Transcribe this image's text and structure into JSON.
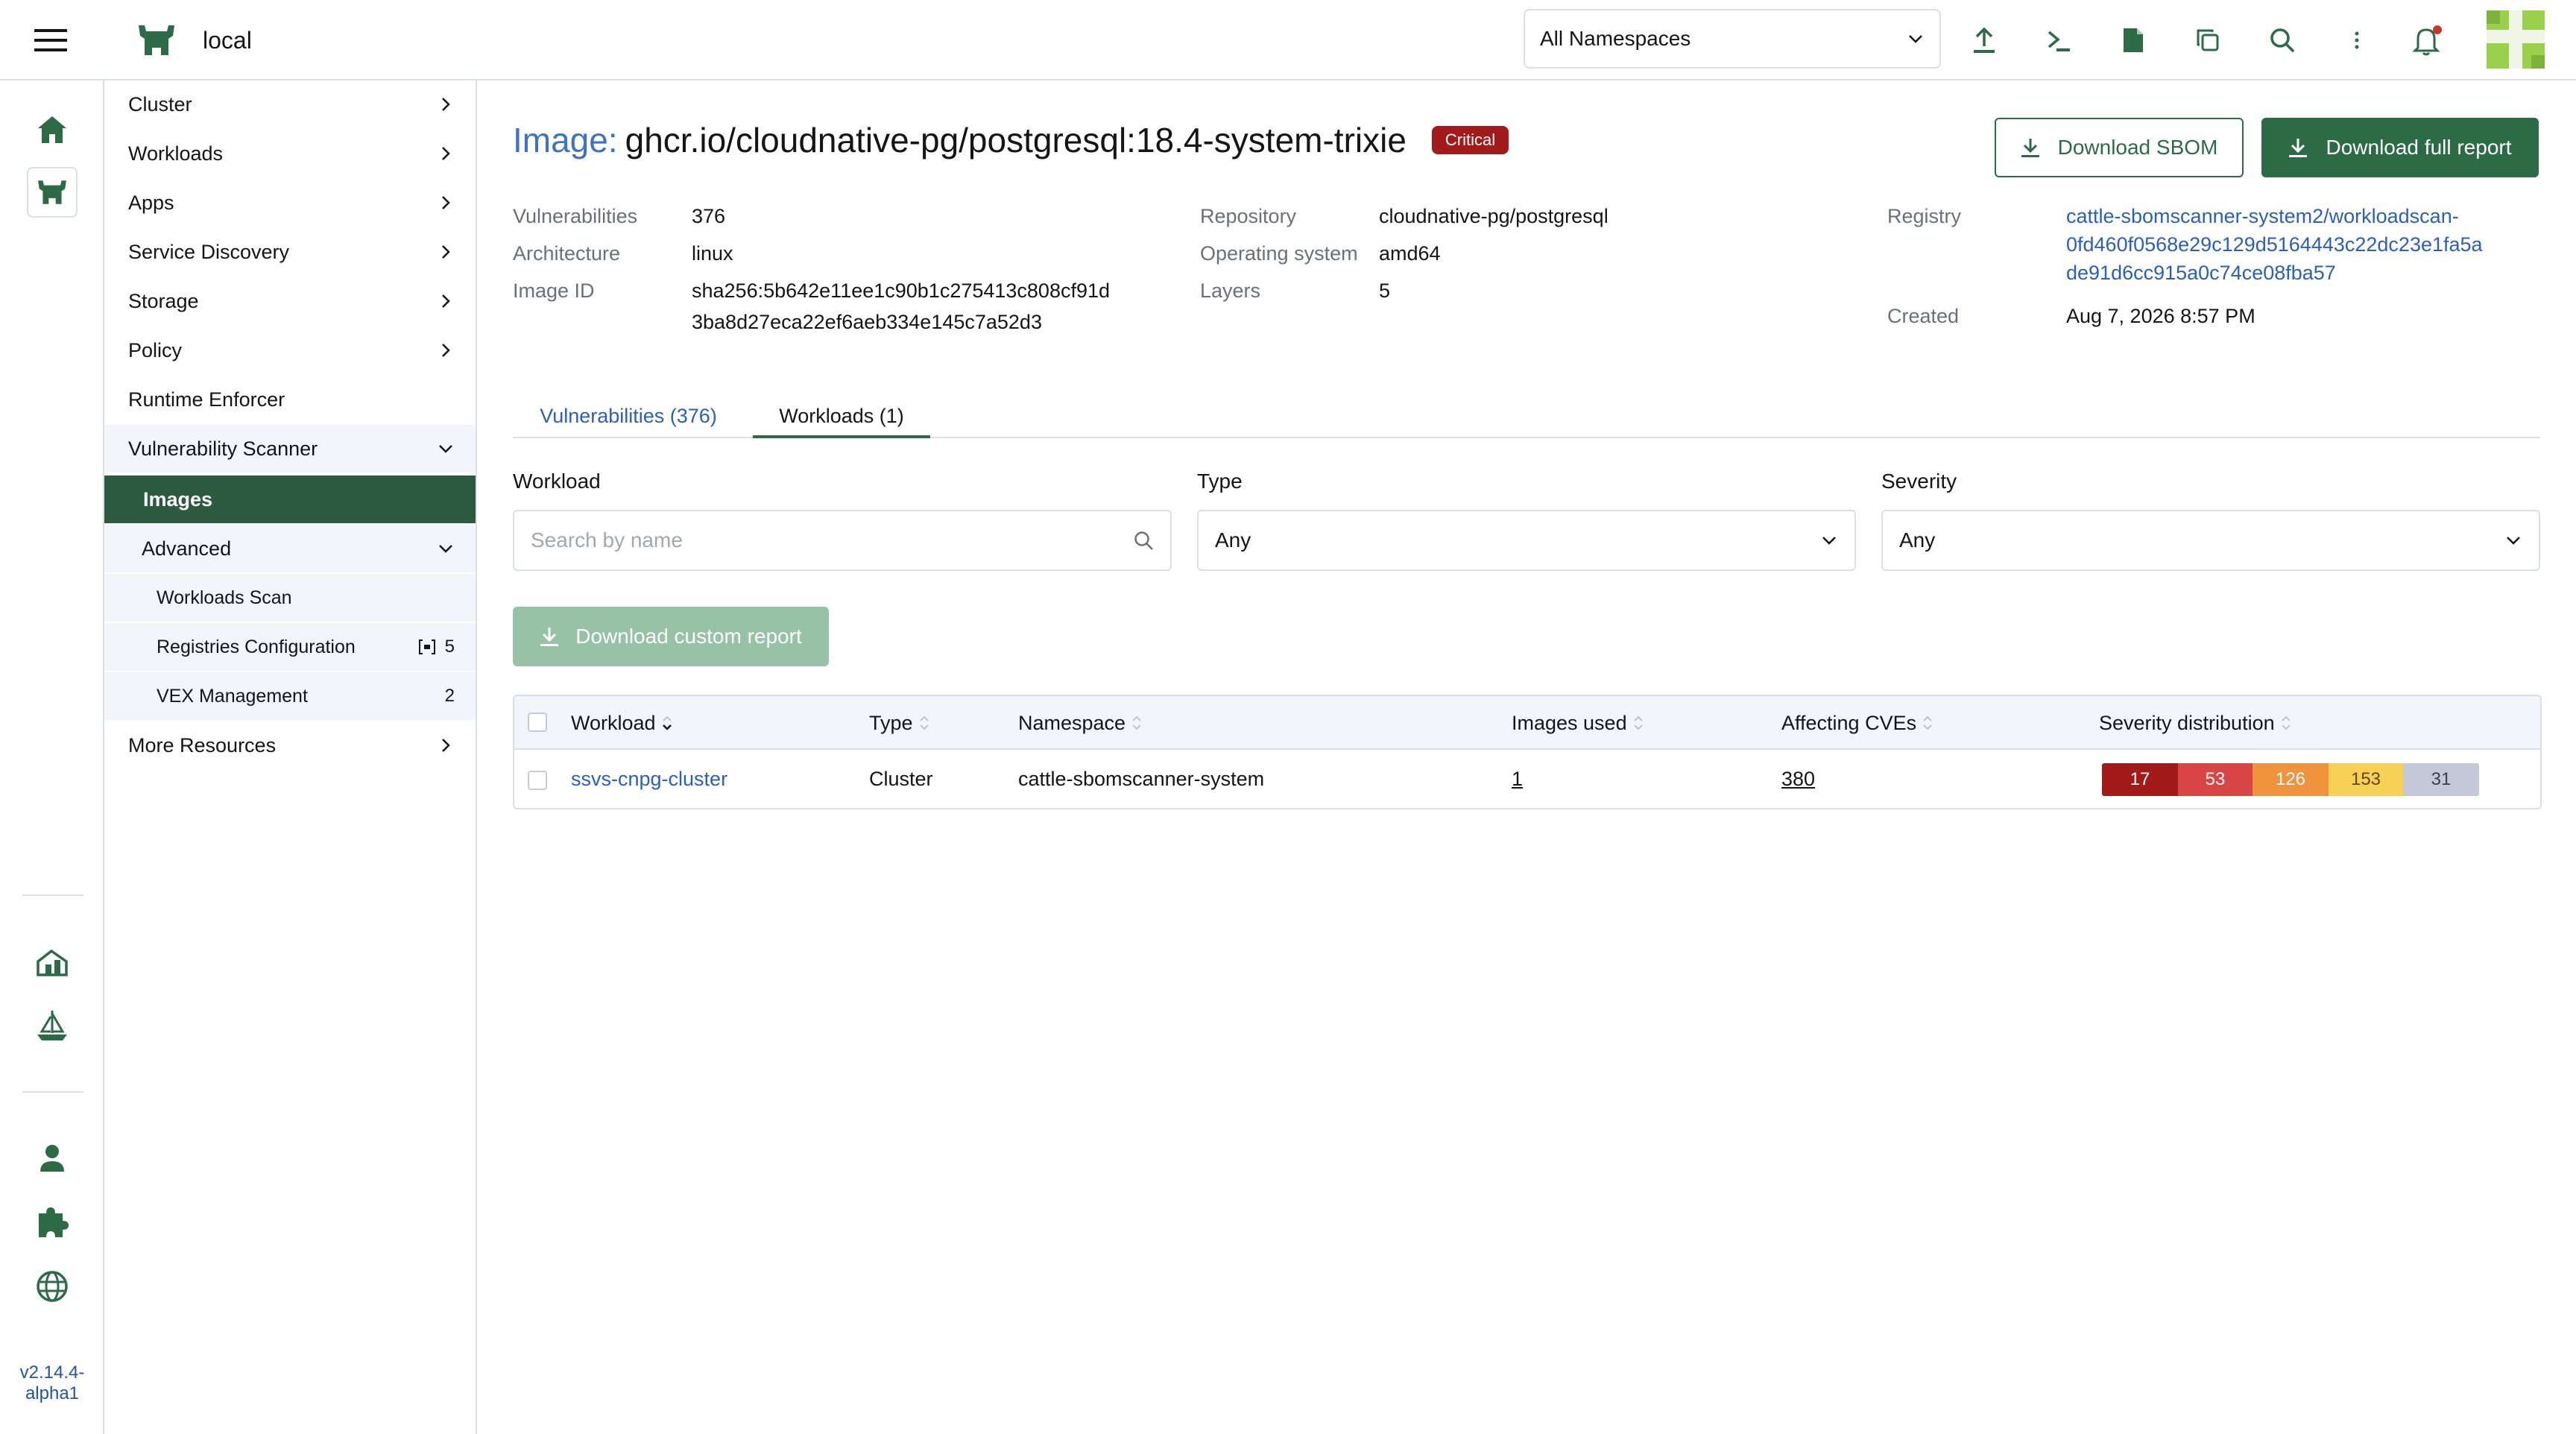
{
  "header": {
    "cluster_name": "local",
    "namespace_select": "All Namespaces"
  },
  "rail": {
    "version": "v2.14.4-alpha1"
  },
  "nav": {
    "items": [
      {
        "label": "Cluster"
      },
      {
        "label": "Workloads"
      },
      {
        "label": "Apps"
      },
      {
        "label": "Service Discovery"
      },
      {
        "label": "Storage"
      },
      {
        "label": "Policy"
      },
      {
        "label": "Runtime Enforcer"
      },
      {
        "label": "Vulnerability Scanner"
      },
      {
        "label": "Images"
      },
      {
        "label": "Advanced"
      },
      {
        "label": "Workloads Scan"
      },
      {
        "label": "Registries Configuration",
        "badge": "5"
      },
      {
        "label": "VEX Management",
        "badge": "2"
      },
      {
        "label": "More Resources"
      }
    ]
  },
  "image": {
    "title_label": "Image:",
    "name": "ghcr.io/cloudnative-pg/postgresql:18.4-system-trixie",
    "severity_badge": "Critical",
    "download_sbom": "Download SBOM",
    "download_full": "Download full report"
  },
  "meta": {
    "vulnerabilities_label": "Vulnerabilities",
    "vulnerabilities_value": "376",
    "architecture_label": "Architecture",
    "architecture_value": "linux",
    "image_id_label": "Image ID",
    "image_id_line1": "sha256:5b642e11ee1c90b1c275413c808cf91d",
    "image_id_line2": "3ba8d27eca22ef6aeb334e145c7a52d3",
    "repository_label": "Repository",
    "repository_value": "cloudnative-pg/postgresql",
    "os_label": "Operating system",
    "os_value": "amd64",
    "layers_label": "Layers",
    "layers_value": "5",
    "registry_label": "Registry",
    "registry_line1": "cattle-sbomscanner-system2/workloadscan-",
    "registry_line2": "0fd460f0568e29c129d5164443c22dc23e1fa5a",
    "registry_line3": "de91d6cc915a0c74ce08fba57",
    "created_label": "Created",
    "created_value": "Aug 7, 2026 8:57 PM"
  },
  "tabs": {
    "vulnerabilities": "Vulnerabilities (376)",
    "workloads": "Workloads (1)"
  },
  "filters": {
    "workload_label": "Workload",
    "workload_placeholder": "Search by name",
    "type_label": "Type",
    "type_value": "Any",
    "severity_label": "Severity",
    "severity_value": "Any",
    "download_custom": "Download custom report"
  },
  "table": {
    "columns": [
      "Workload",
      "Type",
      "Namespace",
      "Images used",
      "Affecting CVEs",
      "Severity distribution"
    ],
    "rows": [
      {
        "workload": "ssvs-cnpg-cluster",
        "type": "Cluster",
        "namespace": "cattle-sbomscanner-system",
        "images_used": "1",
        "affecting_cves": "380",
        "severity": {
          "critical": "17",
          "high": "53",
          "medium": "126",
          "low": "153",
          "unknown": "31"
        }
      }
    ]
  },
  "colors": {
    "brand_green": "#2c6b45",
    "nav_active": "#2c5a3e",
    "critical": "#a31a1a",
    "high": "#d94545",
    "medium": "#ef933d",
    "low": "#f6d155",
    "unknown": "#c5c8d6",
    "link": "#2a5fbf"
  }
}
